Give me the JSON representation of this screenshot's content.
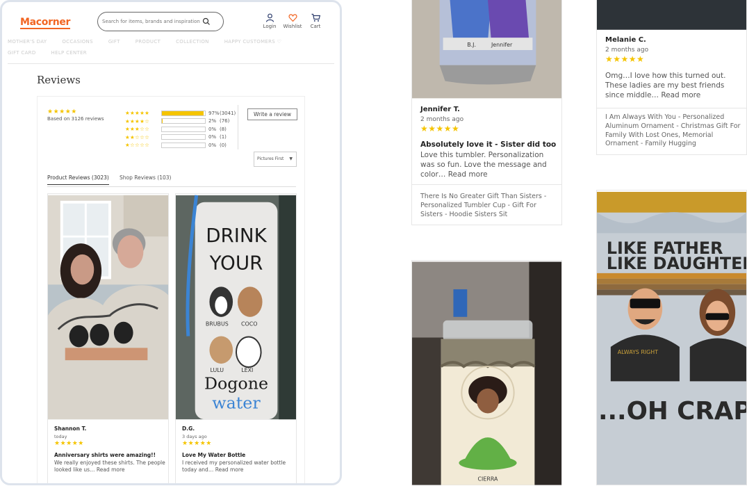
{
  "header": {
    "logo": "Macorner",
    "search_placeholder": "Search for items, brands and inspiration",
    "login": "Login",
    "wishlist": "Wishlist",
    "cart": "Cart"
  },
  "nav": [
    "MOTHER'S DAY",
    "OCCASIONS",
    "GIFT",
    "PRODUCT",
    "COLLECTION",
    "HAPPY CUSTOMERS ♡",
    "GIFT CARD",
    "HELP CENTER"
  ],
  "colors": {
    "brand": "#f26522",
    "star": "#f5c400"
  },
  "reviews": {
    "title": "Reviews",
    "summary_stars": "★★★★★",
    "based_on": "Based on 3126 reviews",
    "histogram": [
      {
        "stars": "★★★★★",
        "percent": "97%",
        "count": "(3041)",
        "fill": 0.97
      },
      {
        "stars": "★★★★☆",
        "percent": "2%",
        "count": "(76)",
        "fill": 0.02
      },
      {
        "stars": "★★★☆☆",
        "percent": "0%",
        "count": "(8)",
        "fill": 0
      },
      {
        "stars": "★★☆☆☆",
        "percent": "0%",
        "count": "(1)",
        "fill": 0
      },
      {
        "stars": "★☆☆☆☆",
        "percent": "0%",
        "count": "(0)",
        "fill": 0
      }
    ],
    "write_button": "Write a review",
    "sort_select": "Pictures First",
    "tabs": [
      "Product Reviews (3023)",
      "Shop Reviews (103)"
    ]
  },
  "cards": [
    {
      "name": "Shannon T.",
      "date": "today",
      "stars": "★★★★★",
      "title": "Anniversary shirts were amazing!!",
      "text": "We really enjoyed these shirts. The people looked like us…",
      "read_more": "Read more"
    },
    {
      "name": "D.G.",
      "date": "3 days ago",
      "stars": "★★★★★",
      "title": "Love My Water Bottle",
      "text": "I received my personalized water bottle today and…",
      "read_more": "Read more",
      "bottle_text": [
        "DRINK",
        "YOUR",
        "BRUBUS",
        "COCO",
        "LULU",
        "LEXI",
        "Dogone",
        "water"
      ]
    },
    {
      "name": "Jennifer T.",
      "date": "2 months ago",
      "stars": "★★★★★",
      "title": "Absolutely love it - Sister did too",
      "text": "Love this tumbler. Personalization was so fun. Love the message and color…",
      "read_more": "Read more",
      "product": "There Is No Greater Gift Than Sisters - Personalized Tumbler Cup - Gift For Sisters - Hoodie Sisters Sit",
      "tumbler_names": [
        "B.J.",
        "Jennifer"
      ]
    },
    {
      "name": "Melanie C.",
      "date": "2 months ago",
      "stars": "★★★★★",
      "text": "Omg…I love how this turned out. These ladies are my best friends since middle…",
      "read_more": "Read more",
      "product": "I Am Always With You - Personalized Aluminum Ornament - Christmas Gift For Family With Lost Ones, Memorial Ornament - Family Hugging"
    },
    {
      "cup_name": "CIERRA"
    },
    {
      "shirt_text": [
        "LIKE FATHER",
        "LIKE DAUGHTER",
        "...OH CRAP",
        "ALWAYS RIGHT"
      ]
    }
  ]
}
